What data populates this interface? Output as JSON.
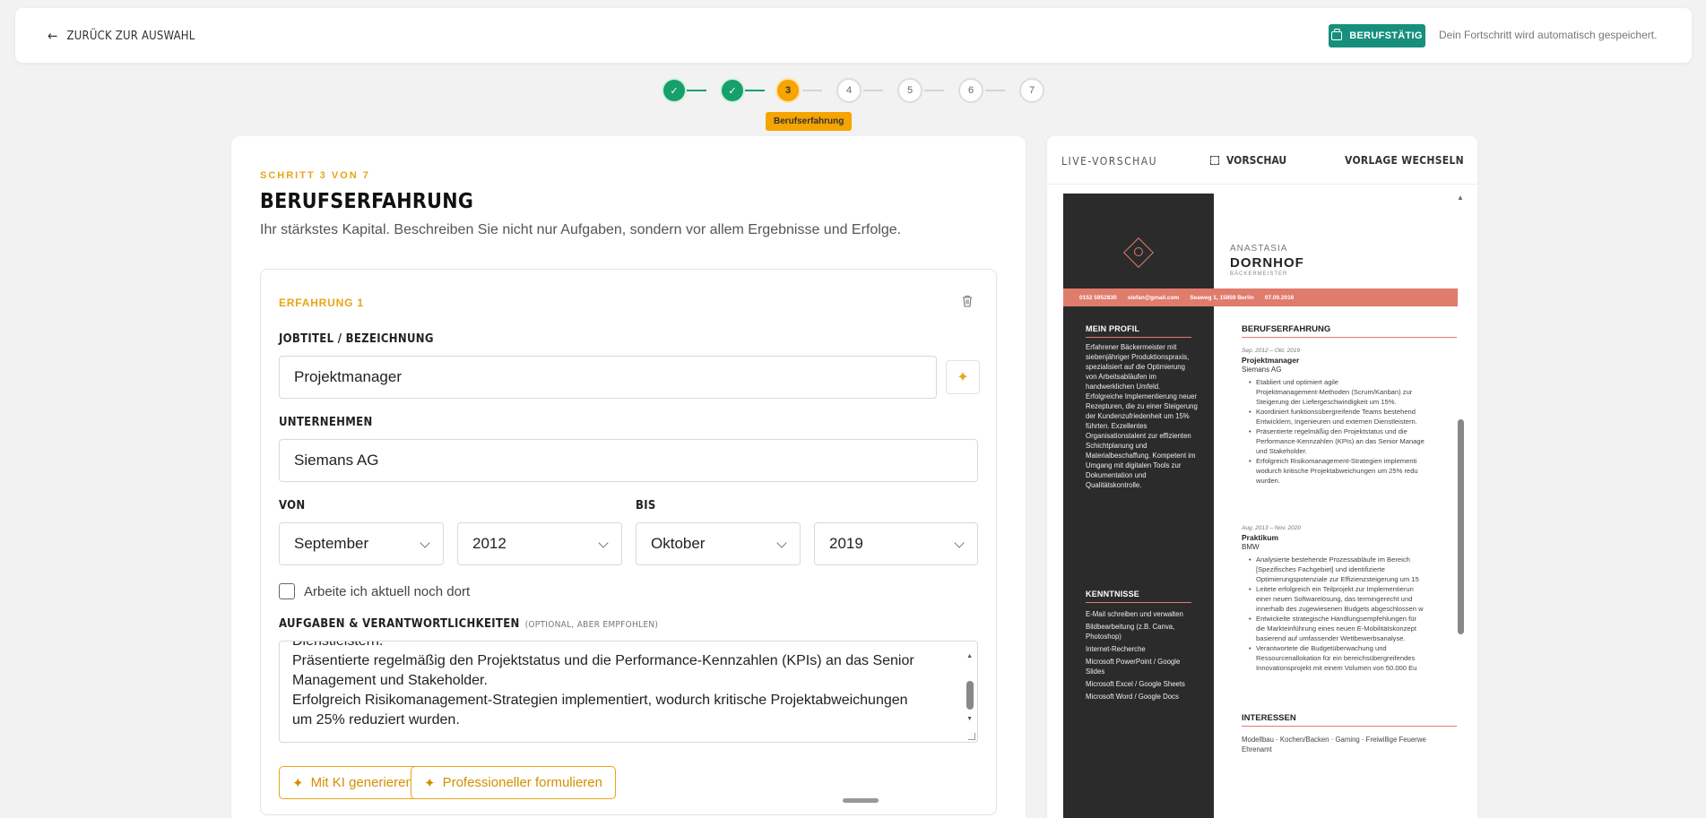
{
  "header": {
    "back_label": "ZURÜCK ZUR AUSWAHL",
    "badge_label": "BERUFSTÄTIG",
    "autosave_text": "Dein Fortschritt wird automatisch gespeichert."
  },
  "stepper": {
    "steps": [
      "3",
      "4",
      "5",
      "6",
      "7"
    ],
    "active_label": "Berufserfahrung"
  },
  "form": {
    "step_of": "SCHRITT 3 VON 7",
    "title": "BERUFSERFAHRUNG",
    "subtitle": "Ihr stärkstes Kapital. Beschreiben Sie nicht nur Aufgaben, sondern vor allem Ergebnisse und Erfolge.",
    "experience_heading": "ERFAHRUNG 1",
    "job_label": "JOBTITEL / BEZEICHNUNG",
    "job_value": "Projektmanager",
    "company_label": "UNTERNEHMEN",
    "company_value": "Siemans AG",
    "from_label": "VON",
    "to_label": "BIS",
    "from_month": "September",
    "from_year": "2012",
    "to_month": "Oktober",
    "to_year": "2019",
    "current_job_label": "Arbeite ich aktuell noch dort",
    "tasks_label": "AUFGABEN & VERANTWORTLICHKEITEN",
    "tasks_optional": "(OPTIONAL, ABER EMPFOHLEN)",
    "tasks_lines": [
      "Dienstleistern.",
      "Präsentierte regelmäßig den Projektstatus und die Performance-Kennzahlen (KPIs) an das Senior",
      "Management und Stakeholder.",
      "Erfolgreich Risikomanagement-Strategien implementiert, wodurch kritische Projektabweichungen",
      "um 25% reduziert wurden."
    ],
    "ai_generate_label": "Mit KI generieren",
    "ai_rephrase_label": "Professioneller formulieren"
  },
  "preview": {
    "live_label": "LIVE-VORSCHAU",
    "preview_label": "VORSCHAU",
    "template_label": "VORLAGE WECHSELN",
    "cv": {
      "first_name": "ANASTASIA",
      "last_name": "DORNHOF",
      "role": "BÄCKERMEISTER",
      "phone": "0152 5952830",
      "email": "stefan@gmail.com",
      "address": "Seaweg 1, 15859 Berlin",
      "birthdate": "07.09.2016",
      "profile_heading": "MEIN PROFIL",
      "profile_text": "Erfahrener Bäckermeister mit siebenjähriger Produktionspraxis, spezialisiert auf die Optimierung von Arbeitsabläufen im handwerklichen Umfeld. Erfolgreiche Implementierung neuer Rezepturen, die zu einer Steigerung der Kundenzufriedenheit um 15% führten. Exzellentes Organisationstalent zur effizienten Schichtplanung und Materialbeschaffung. Kompetent im Umgang mit digitalen Tools zur Dokumentation und Qualitätskontrolle.",
      "skills_heading": "KENNTNISSE",
      "skills": [
        "E-Mail schreiben und verwalten",
        "Bildbearbeitung (z.B. Canva, Photoshop)",
        "Internet-Recherche",
        "Microsoft PowerPoint / Google Slides",
        "Microsoft Excel / Google Sheets",
        "Microsoft Word / Google Docs"
      ],
      "experience_heading": "BERUFSERFAHRUNG",
      "jobs": [
        {
          "date": "Sep. 2012 – Okt. 2019",
          "title": "Projektmanager",
          "company": "Siemans AG",
          "bullets": [
            "Etabliert und optimiert agile",
            "Projektmanagement-Methoden (Scrum/Kanban) zur",
            "Steigerung der Liefergeschwindigkeit um 15%.",
            "Koordiniert funktionsübergreifende Teams bestehend",
            "Entwicklern, Ingenieuren und externen Dienstleistern.",
            "Präsentierte regelmäßig den Projektstatus und die",
            "Performance-Kennzahlen (KPIs) an das Senior Manage",
            "und Stakeholder.",
            "Erfolgreich Risikomanagement-Strategien implementi",
            "wodurch kritische Projektabweichungen um 25% redu",
            "wurden."
          ]
        },
        {
          "date": "Aug. 2013 – Nov. 2020",
          "title": "Praktikum",
          "company": "BMW",
          "bullets": [
            "Analysierte bestehende Prozessabläufe im Bereich",
            "[Spezifisches Fachgebiet] und identifizierte",
            "Optimierungspotenziale zur Effizienzsteigerung um 15",
            "Leitete erfolgreich ein Teilprojekt zur Implementierun",
            "einer neuen Softwarelösung, das termingerecht und",
            "innerhalb des zugewiesenen Budgets abgeschlossen w",
            "Entwickelte strategische Handlungsempfehlungen für",
            "die Markteinführung eines neuen E-Mobilitätskonzept",
            "basierend auf umfassender Wettbewerbsanalyse.",
            "Verantwortete die Budgetüberwachung und",
            "Ressourcenallokation für ein bereichsübergreifendes",
            "Innovationsprojekt mit einem Volumen von 50.000 Eu"
          ]
        }
      ],
      "interests_heading": "INTERESSEN",
      "interests_line1": "Modellbau · Kochen/Backen · Gaming · Freiwillige Feuerwe",
      "interests_line2": "Ehrenamt"
    }
  }
}
